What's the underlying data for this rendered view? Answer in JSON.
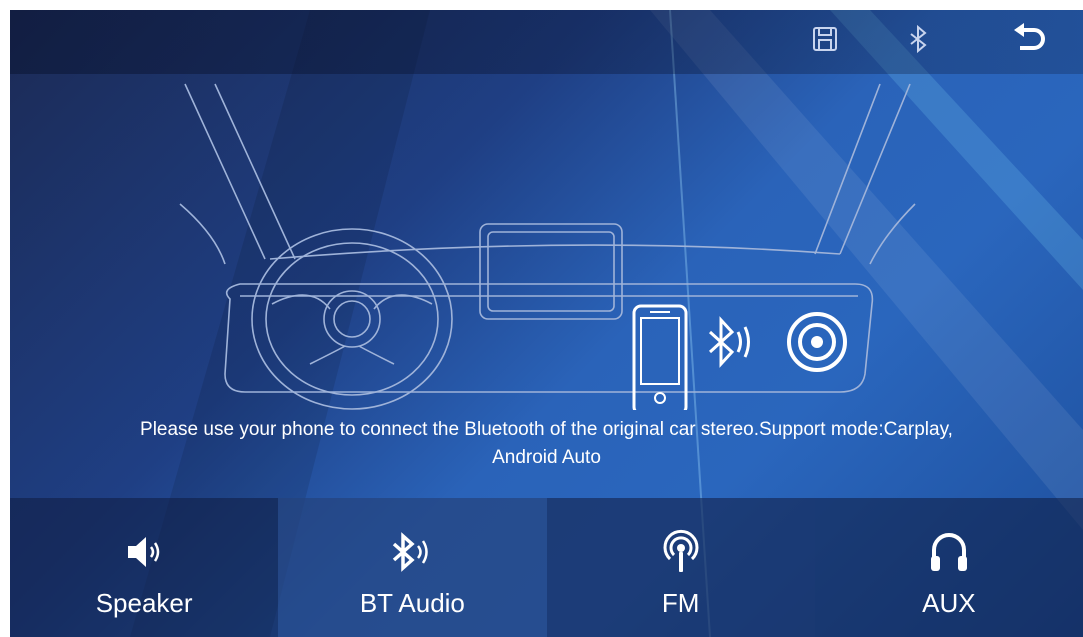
{
  "topbar": {
    "icons": [
      "save-icon",
      "bluetooth-icon",
      "back-icon"
    ]
  },
  "message": {
    "line1": "Please use your phone to connect the Bluetooth of the original car stereo.Support mode:Carplay,",
    "line2": "Android Auto"
  },
  "modes": [
    {
      "label": "Speaker",
      "icon": "speaker-icon"
    },
    {
      "label": "BT Audio",
      "icon": "bluetooth-audio-icon"
    },
    {
      "label": "FM",
      "icon": "radio-antenna-icon"
    },
    {
      "label": "AUX",
      "icon": "headphones-icon"
    }
  ],
  "colors": {
    "background_dark": "#1b2a55",
    "background_light": "#2a63b9",
    "line_art": "#9fb3d9",
    "text": "#ffffff"
  }
}
